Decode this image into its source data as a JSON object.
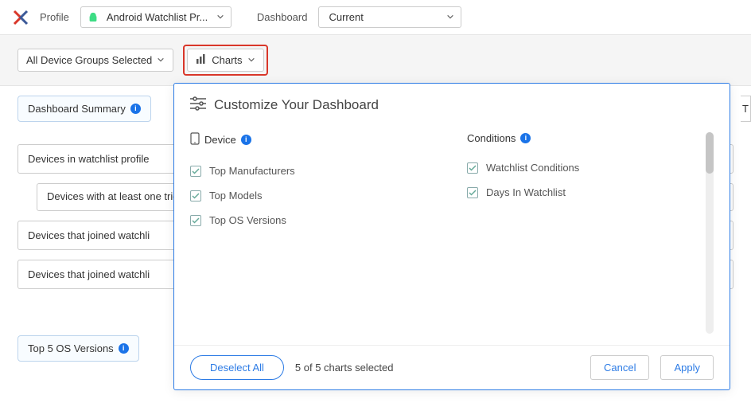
{
  "header": {
    "profile_label": "Profile",
    "profile_value": "Android Watchlist Pr...",
    "dashboard_label": "Dashboard",
    "dashboard_value": "Current"
  },
  "toolbar": {
    "device_groups": "All Device Groups Selected",
    "charts_label": "Charts"
  },
  "tabs": {
    "summary": "Dashboard Summary",
    "top_os": "Top 5 OS Versions"
  },
  "tree": {
    "item1": "Devices in watchlist profile",
    "item1a": "Devices with at least one triggered condition",
    "item2": "Devices that joined watchli",
    "item3": "Devices that joined watchli"
  },
  "modal": {
    "title": "Customize Your Dashboard",
    "device_header": "Device",
    "conditions_header": "Conditions",
    "options": {
      "top_manufacturers": "Top Manufacturers",
      "top_models": "Top Models",
      "top_os": "Top OS Versions",
      "watchlist_conditions": "Watchlist Conditions",
      "days_in_watchlist": "Days In Watchlist"
    },
    "deselect": "Deselect All",
    "status": "5 of 5 charts selected",
    "cancel": "Cancel",
    "apply": "Apply"
  },
  "side_t": "T"
}
